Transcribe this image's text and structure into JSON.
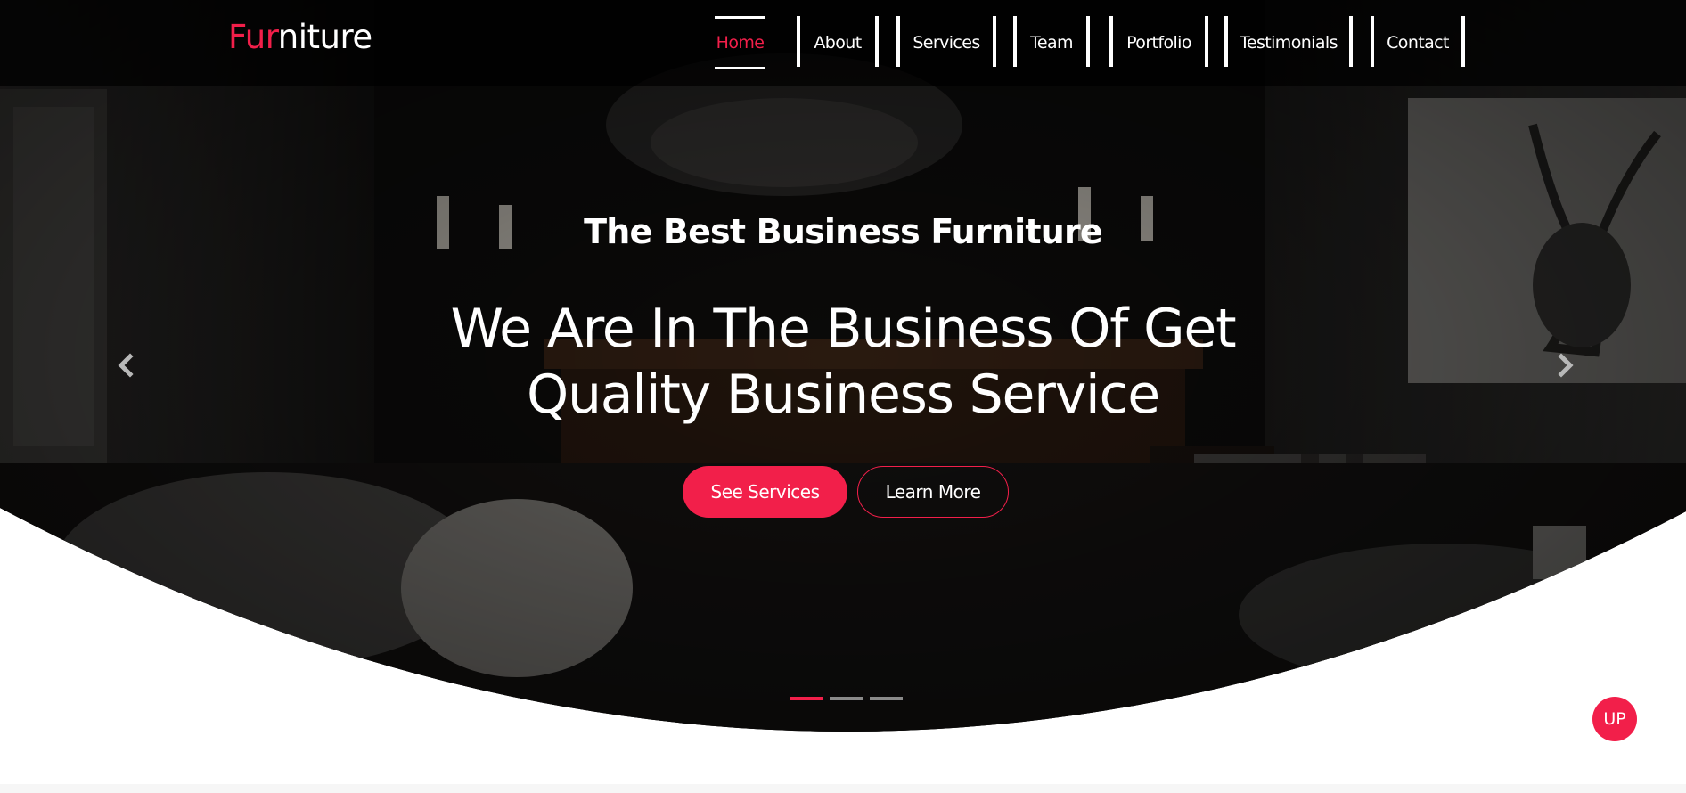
{
  "brand": {
    "logo_accent": "Fur",
    "logo_rest": "niture"
  },
  "nav": {
    "items": [
      {
        "label": "Home",
        "active": true
      },
      {
        "label": "About"
      },
      {
        "label": "Services"
      },
      {
        "label": "Team"
      },
      {
        "label": "Portfolio"
      },
      {
        "label": "Testimonials"
      },
      {
        "label": "Contact"
      }
    ]
  },
  "hero": {
    "subtitle": "The Best Business Furniture",
    "headline_line1": "We Are In The Business Of Get",
    "headline_line2": "Quality Business Service",
    "primary_button": "See Services",
    "secondary_button": "Learn More",
    "prev_icon": "chevron-left-icon",
    "next_icon": "chevron-right-icon",
    "slides": [
      {
        "active": true
      },
      {
        "active": false
      },
      {
        "active": false
      }
    ]
  },
  "up_button": {
    "label": "UP"
  },
  "colors": {
    "accent": "#f21f4a",
    "navbar": "#000000",
    "text": "#ffffff",
    "page": "#ffffff"
  }
}
